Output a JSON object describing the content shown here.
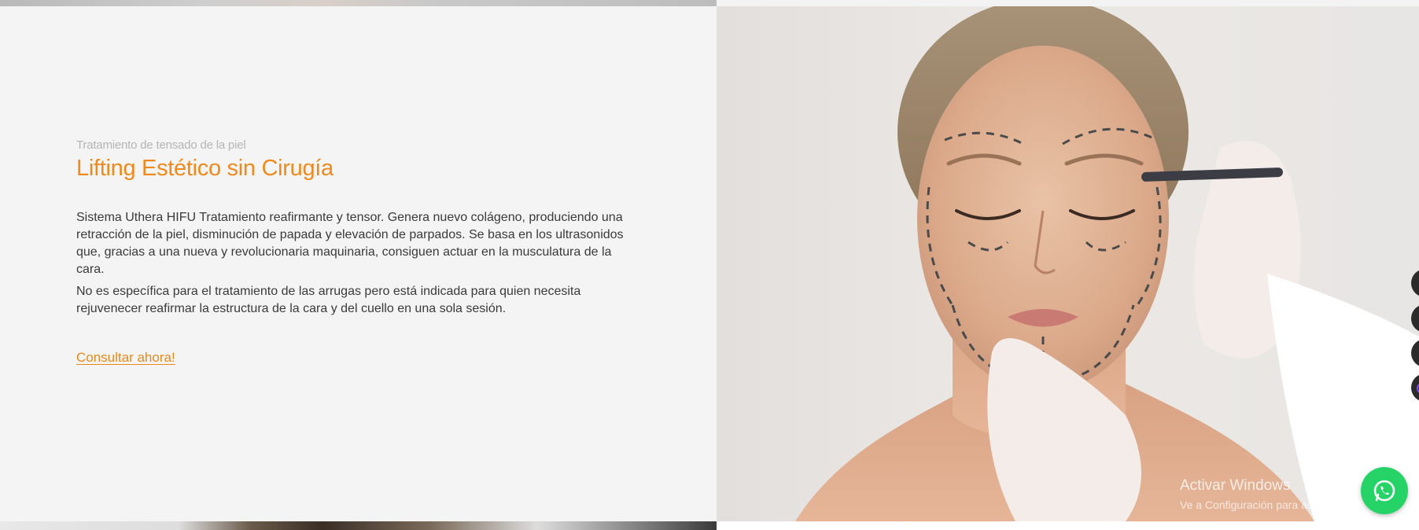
{
  "section": {
    "subtitle": "Tratamiento de tensado de la piel",
    "title": "Lifting Estético sin Cirugía",
    "paragraphs": [
      "Sistema Uthera HIFU Tratamiento reafirmante y tensor. Genera nuevo colágeno, produciendo una retracción de la piel, disminución de papada y elevación de parpados. Se basa en los ultrasonidos que, gracias a una nueva y revolucionaria maquinaria, consiguen actuar en la musculatura de la cara.",
      "No es específica para el tratamiento de las arrugas pero está indicada para quien necesita rejuvenecer reafirmar la estructura de la cara y del cuello en una sola sesión."
    ],
    "cta_label": "Consultar ahora!"
  },
  "image": {
    "subject": "face-marked-for-lifting-photo"
  },
  "floating": {
    "whatsapp_icon": "whatsapp-icon",
    "side_icons": [
      "social-icon",
      "social-icon",
      "social-icon",
      "instagram-icon"
    ]
  },
  "watermark": {
    "title": "Activar Windows",
    "subtitle": "Ve a Configuración para activar Windows."
  },
  "colors": {
    "accent": "#ee8a1c",
    "panel_bg": "#f4f4f4",
    "body_text": "#3a3a3a",
    "subtitle_text": "#b5b5b5",
    "whatsapp": "#25d366"
  }
}
